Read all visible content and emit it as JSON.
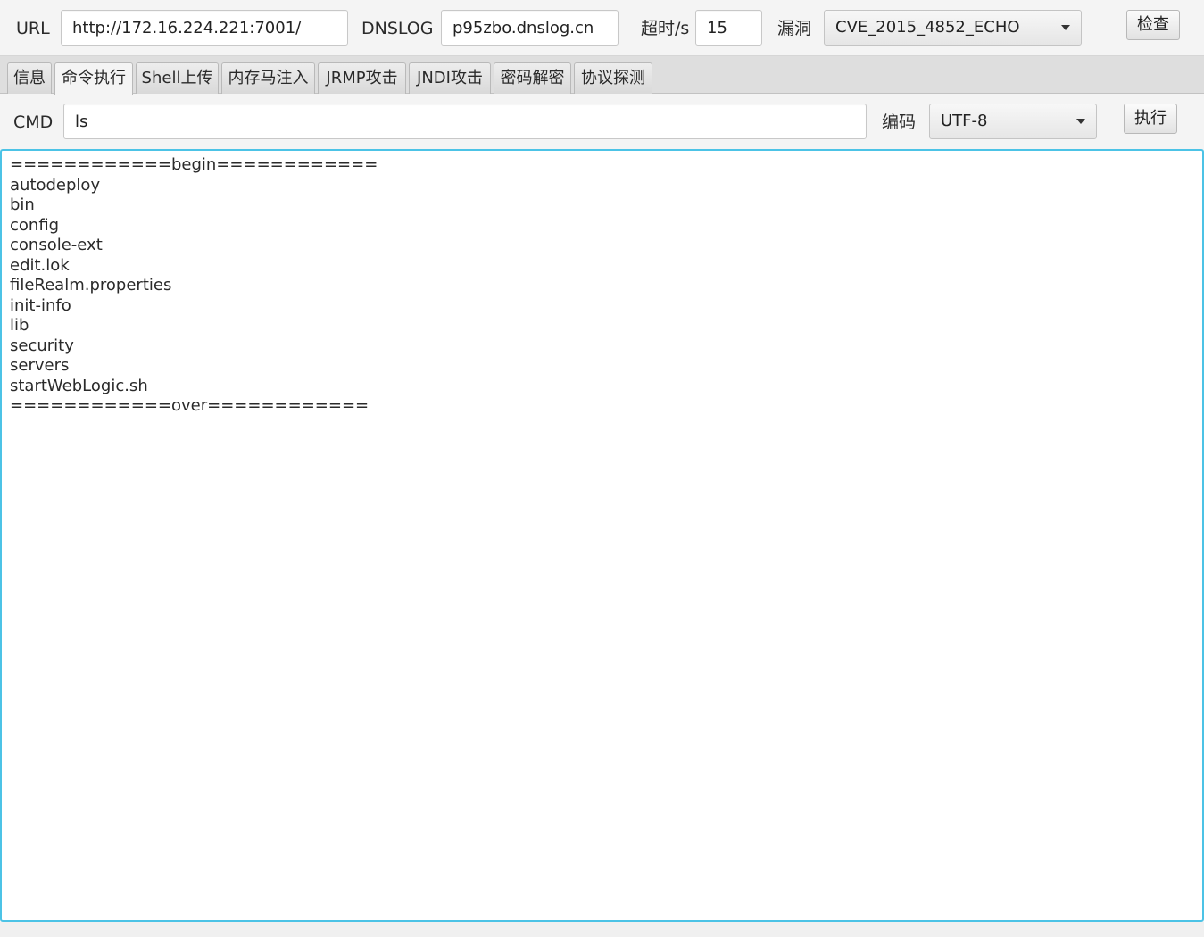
{
  "toolbar": {
    "url_label": "URL",
    "url_value": "http://172.16.224.221:7001/",
    "dnslog_label": "DNSLOG",
    "dnslog_value": "p95zbo.dnslog.cn",
    "timeout_label": "超时/s",
    "timeout_value": "15",
    "vuln_label": "漏洞",
    "vuln_selected": "CVE_2015_4852_ECHO",
    "check_button": "检查"
  },
  "tabs": [
    {
      "label": "信息",
      "active": false
    },
    {
      "label": "命令执行",
      "active": true
    },
    {
      "label": "Shell上传",
      "active": false
    },
    {
      "label": "内存马注入",
      "active": false
    },
    {
      "label": "JRMP攻击",
      "active": false
    },
    {
      "label": "JNDI攻击",
      "active": false
    },
    {
      "label": "密码解密",
      "active": false
    },
    {
      "label": "协议探测",
      "active": false
    }
  ],
  "command": {
    "cmd_label": "CMD",
    "cmd_value": "ls",
    "encoding_label": "编码",
    "encoding_selected": "UTF-8",
    "execute_button": "执行"
  },
  "output": {
    "lines": [
      "============begin============",
      "autodeploy",
      "bin",
      "config",
      "console-ext",
      "edit.lok",
      "fileRealm.properties",
      "init-info",
      "lib",
      "security",
      "servers",
      "startWebLogic.sh",
      "============over============"
    ]
  },
  "colors": {
    "focus_border": "#4cc3e6",
    "background": "#f4f4f4"
  }
}
